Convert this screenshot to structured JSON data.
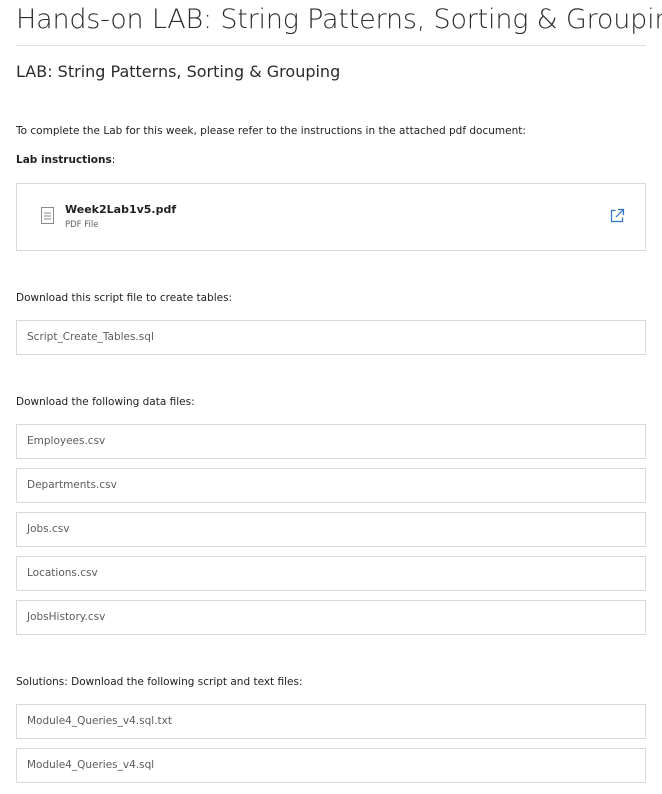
{
  "header": {
    "title": "Hands-on LAB: String Patterns, Sorting & Grouping",
    "subtitle": "LAB: String Patterns, Sorting & Grouping"
  },
  "intro": {
    "text": "To complete the Lab for this week, please refer to the instructions in the attached pdf document:",
    "instructions_label": "Lab instructions",
    "instructions_colon": ":"
  },
  "attachment": {
    "name": "Week2Lab1v5.pdf",
    "type": "PDF File"
  },
  "script_section": {
    "label": "Download this script file to create tables:",
    "files": [
      "Script_Create_Tables.sql"
    ]
  },
  "data_section": {
    "label": "Download the following data files:",
    "files": [
      "Employees.csv",
      "Departments.csv",
      "Jobs.csv",
      "Locations.csv",
      "JobsHistory.csv"
    ]
  },
  "solutions_section": {
    "label": "Solutions: Download the following script and text files:",
    "files": [
      "Module4_Queries_v4.sql.txt",
      "Module4_Queries_v4.sql"
    ]
  },
  "colors": {
    "accent": "#2a73cc",
    "border": "#d9d9d9"
  },
  "icons": {
    "attachment": "document-icon",
    "open": "external-link-icon"
  }
}
